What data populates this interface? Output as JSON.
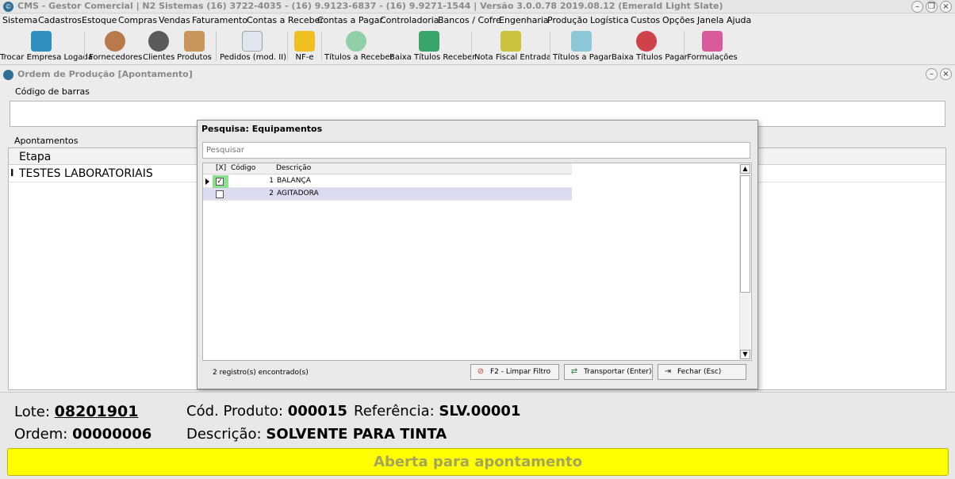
{
  "titlebar": {
    "title": "CMS - Gestor Comercial | N2 Sistemas (16) 3722-4035 - (16) 9.9123-6837 - (16) 9.9271-1544 | Versão 3.0.0.78 2019.08.12 (Emerald Light Slate)"
  },
  "menu": [
    "Sistema",
    "Cadastros",
    "Estoque",
    "Compras",
    "Vendas",
    "Faturamento",
    "Contas a Receber",
    "Contas a Pagar",
    "Controladoria",
    "Bancos / Cofre",
    "Engenharia",
    "Produção",
    "Logística",
    "Custos",
    "Opções",
    "Janela",
    "Ajuda"
  ],
  "toolbar": [
    "Trocar Empresa Logada",
    "Fornecedores",
    "Clientes",
    "Produtos",
    "Pedidos (mod. II)",
    "NF-e",
    "Títulos a Receber",
    "Baixa Títulos Receber",
    "Nota Fiscal Entrada",
    "Títulos a Pagar",
    "Baixa Títulos Pagar",
    "Formulações"
  ],
  "child_window": {
    "title": "Ordem de Produção [Apontamento]"
  },
  "barcode": {
    "label": "Código de barras"
  },
  "apontamentos": {
    "label": "Apontamentos",
    "column": "Etapa",
    "row_indicator": "I",
    "rows": [
      "TESTES LABORATORIAIS"
    ]
  },
  "modal": {
    "title": "Pesquisa: Equipamentos",
    "search_placeholder": "Pesquisar",
    "columns": {
      "check": "[X]",
      "code": "Código",
      "desc": "Descrição"
    },
    "rows": [
      {
        "code": "1",
        "desc": "BALANÇA",
        "checked": true
      },
      {
        "code": "2",
        "desc": "AGITADORA",
        "checked": false
      }
    ],
    "count_text": "2 registro(s) encontrado(s)",
    "btn_clear": "F2 - Limpar Filtro",
    "btn_transport": "Transportar (Enter)",
    "btn_close": "Fechar (Esc)"
  },
  "info": {
    "lote_label": "Lote:",
    "lote": "08201901",
    "ordem_label": "Ordem:",
    "ordem": "00000006",
    "cod_label": "Cód. Produto:",
    "cod": "000015",
    "ref_label": "Referência:",
    "ref": "SLV.00001",
    "desc_label": "Descrição:",
    "desc": "SOLVENTE PARA TINTA"
  },
  "status": "Aberta para apontamento",
  "colors": {
    "status_bg": "#ffff00",
    "status_text": "#a4a45a",
    "checked_cell": "#8de08d",
    "row_alt": "#dcdcf0"
  }
}
